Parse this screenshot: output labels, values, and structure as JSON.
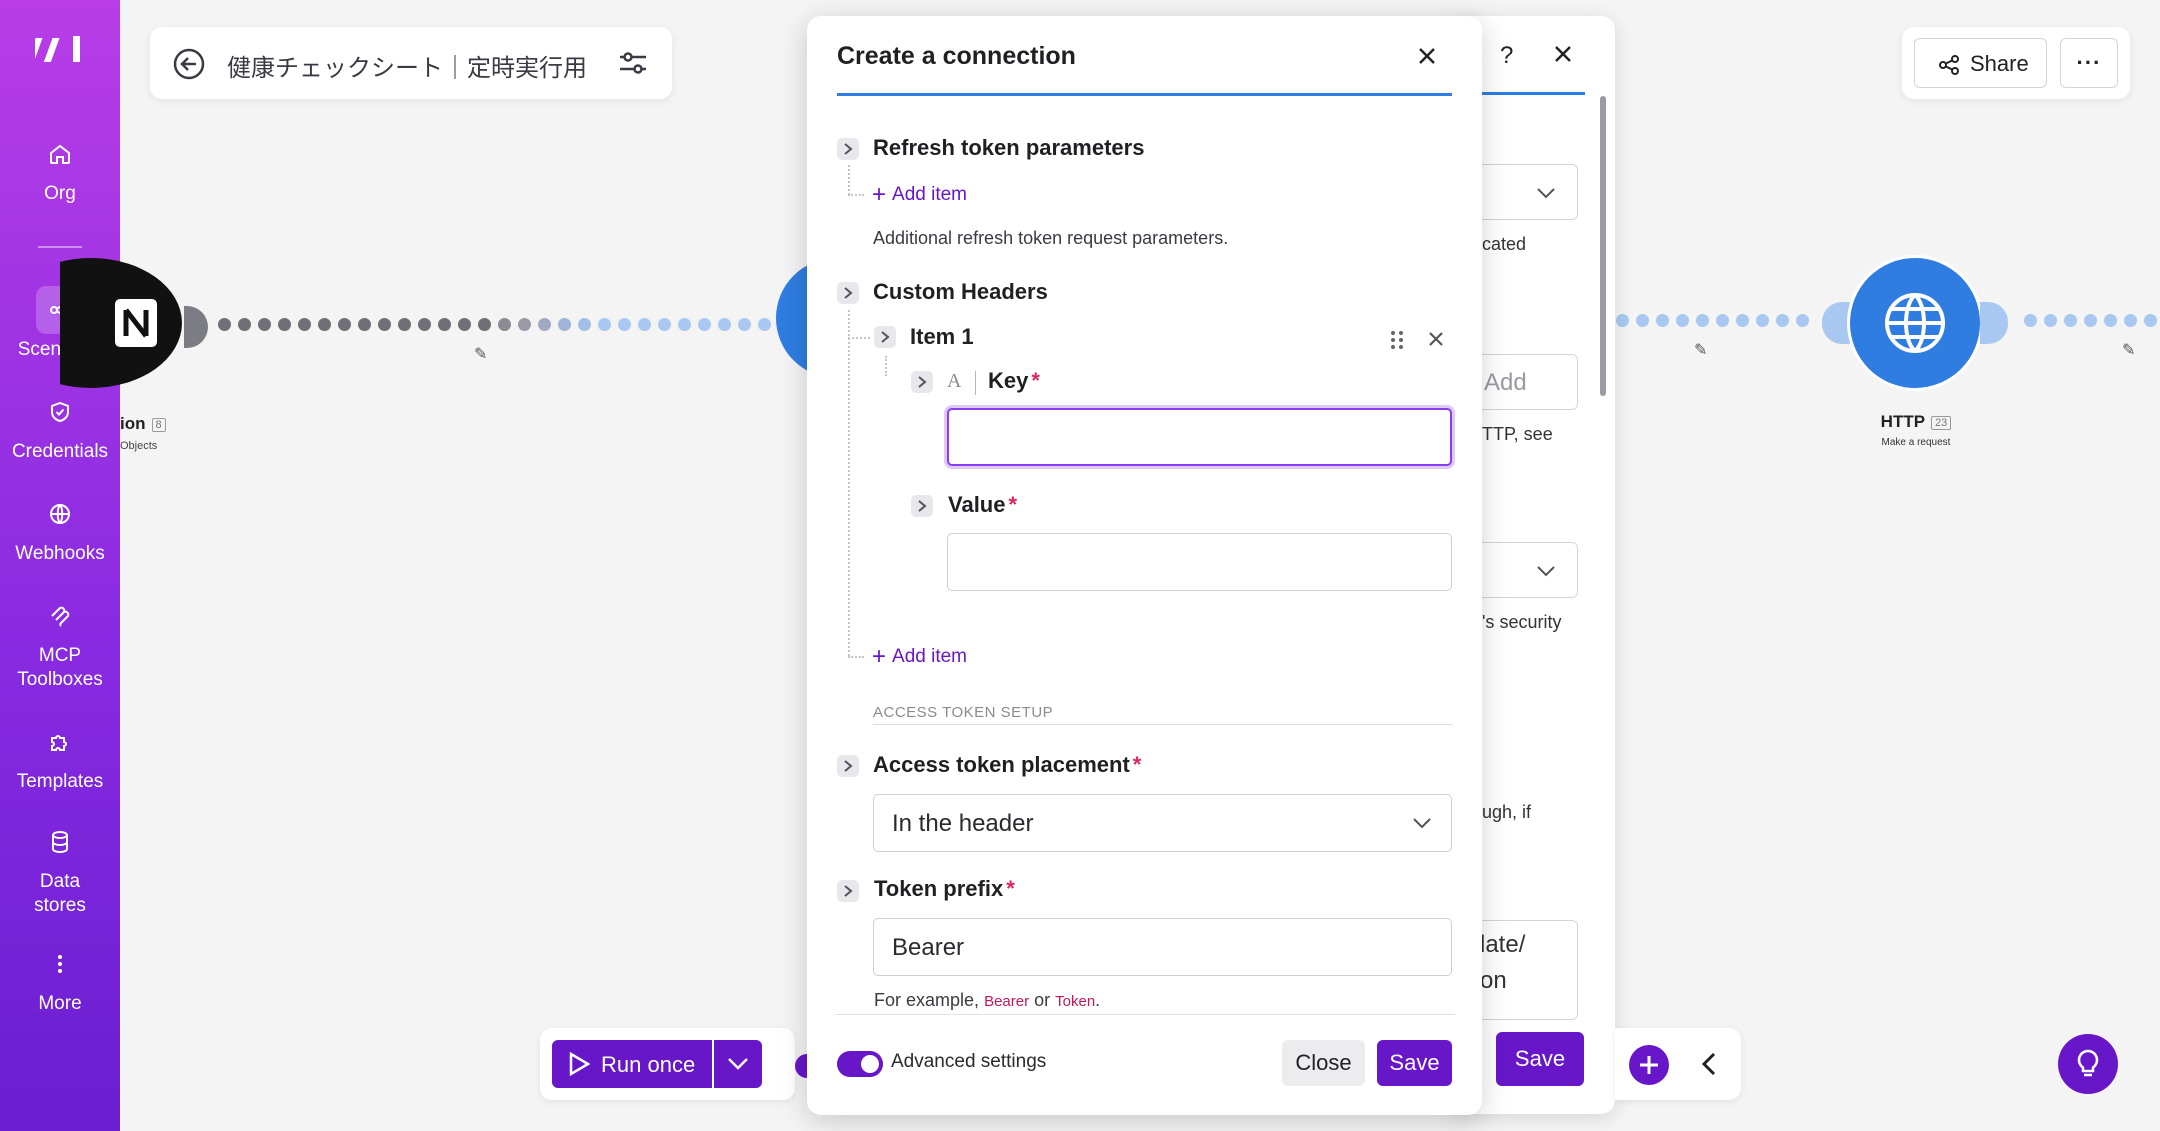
{
  "sidebar": {
    "items": [
      {
        "label": "Org",
        "icon": "home-icon"
      },
      {
        "label": "Scenarios",
        "icon": "share-nodes-icon"
      },
      {
        "label": "Credentials",
        "icon": "shield-check-icon"
      },
      {
        "label": "Webhooks",
        "icon": "globe-icon"
      },
      {
        "label": "MCP",
        "label2": "Toolboxes",
        "icon": "mcp-icon"
      },
      {
        "label": "Templates",
        "icon": "puzzle-icon"
      },
      {
        "label": "Data",
        "label2": "stores",
        "icon": "database-icon"
      },
      {
        "label": "More",
        "icon": "vertical-dots-icon"
      }
    ]
  },
  "scenario": {
    "title": "健康チェックシート｜定時実行用"
  },
  "canvas": {
    "left_node": {
      "label": "ion",
      "badge": "8",
      "sub": "Objects"
    },
    "http_node": {
      "label": "HTTP",
      "badge": "23",
      "sub": "Make a request"
    }
  },
  "topright": {
    "share_label": "Share",
    "more_label": "···"
  },
  "bg_panel": {
    "help": "?",
    "texts": [
      "cated",
      "TTP, see",
      "'s security",
      "ugh, if"
    ],
    "add_label": "Add",
    "textarea_line1": "late/",
    "textarea_line2": "on",
    "save_label": "Save"
  },
  "toolbar": {
    "run_label": "Run once"
  },
  "modal": {
    "title": "Create a connection",
    "refresh_title": "Refresh token parameters",
    "add_item": "Add item",
    "refresh_help": "Additional refresh token request parameters.",
    "custom_headers_title": "Custom Headers",
    "item1_title": "Item 1",
    "key_label": "Key",
    "key_value": "",
    "value_label": "Value",
    "value_value": "",
    "add_item_2": "Add item",
    "section_caption": "ACCESS TOKEN SETUP",
    "placement_label": "Access token placement",
    "placement_value": "In the header",
    "prefix_label": "Token prefix",
    "prefix_value": "Bearer",
    "example_prefix": "For example,",
    "example_a": "Bearer",
    "example_or": "or",
    "example_b": "Token",
    "example_end": ".",
    "advanced_label": "Advanced settings",
    "advanced_on": true,
    "close_label": "Close",
    "save_label": "Save"
  },
  "colors": {
    "brand_purple": "#6716c8",
    "accent_blue": "#2f7de1",
    "required_red": "#e0245e"
  }
}
